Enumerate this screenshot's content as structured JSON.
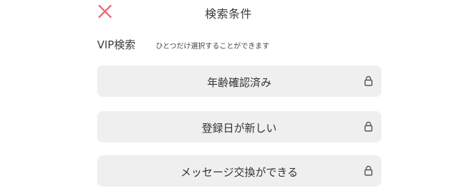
{
  "header": {
    "title": "検索条件",
    "close_icon": "close-icon",
    "close_color": "#e8707a"
  },
  "vip_section": {
    "title": "VIP検索",
    "note": "ひとつだけ選択することができます"
  },
  "options": [
    {
      "label": "年齢確認済み",
      "icon": "lock-icon"
    },
    {
      "label": "登録日が新しい",
      "icon": "lock-icon"
    },
    {
      "label": "メッセージ交換ができる",
      "icon": "lock-icon"
    }
  ],
  "colors": {
    "option_bg": "#efefef",
    "text": "#333333"
  }
}
